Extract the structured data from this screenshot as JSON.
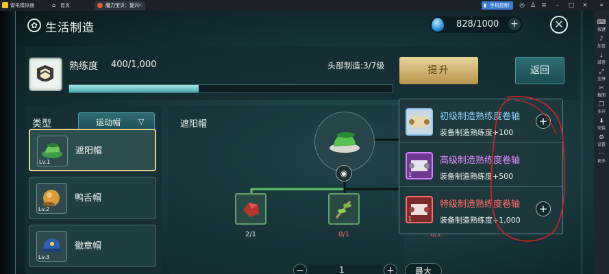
{
  "emulator": {
    "app_name": "雷电模拟器",
    "tabs": [
      {
        "label": "首页",
        "active": false
      },
      {
        "label": "魔力宝贝：复兴",
        "active": true
      }
    ],
    "remote_control": "手机控制",
    "sidebar": [
      {
        "icon": "keyboard-icon",
        "label": "按键"
      },
      {
        "icon": "volume-up-icon",
        "label": "加音"
      },
      {
        "icon": "volume-down-icon",
        "label": "减音"
      },
      {
        "icon": "fullscreen-icon",
        "label": "全屏"
      },
      {
        "icon": "scissors-icon",
        "label": "截图"
      },
      {
        "icon": "multi-instance-icon",
        "label": "多开"
      },
      {
        "icon": "install-icon",
        "label": "安装"
      },
      {
        "icon": "settings-icon",
        "label": "设置"
      },
      {
        "icon": "more-icon",
        "label": "更多"
      }
    ]
  },
  "header": {
    "title": "生活制造",
    "currency_value": "828/1000"
  },
  "proficiency": {
    "label": "熟练度",
    "value": "400/1,000",
    "progress": 0.4,
    "head_craft": "头部制造:3/7级",
    "upgrade_label": "提升",
    "return_label": "返回"
  },
  "list": {
    "type_label": "类型",
    "type_value": "运动帽",
    "items": [
      {
        "name": "遮阳帽",
        "level": "Lv.1",
        "selected": true
      },
      {
        "name": "鸭舌帽",
        "level": "Lv.2",
        "selected": false
      },
      {
        "name": "徽章帽",
        "level": "Lv.3",
        "selected": false
      }
    ]
  },
  "recipe": {
    "title": "遮阳帽",
    "materials": [
      {
        "count": "2/1",
        "color": "#eef3ee"
      },
      {
        "count": "0/1",
        "color": "#ff6b6b"
      },
      {
        "count": "0/1",
        "color": "#ff6b6b"
      }
    ],
    "quantity": "1",
    "max_label": "最大"
  },
  "scrolls": [
    {
      "name": "初级制造熟练度卷轴",
      "desc": "装备制造熟练度+100",
      "color": "#8fd2ff",
      "num": ""
    },
    {
      "name": "高级制造熟练度卷轴",
      "desc": "装备制造熟练度+500",
      "color": "#e08cff",
      "num": "1"
    },
    {
      "name": "特级制造熟练度卷轴",
      "desc": "装备制造熟练度+1,000",
      "color": "#ff6a6a",
      "num": "1"
    }
  ],
  "colors": {
    "accent_gold": "#e7d48c",
    "annotation_red": "#d22424"
  }
}
